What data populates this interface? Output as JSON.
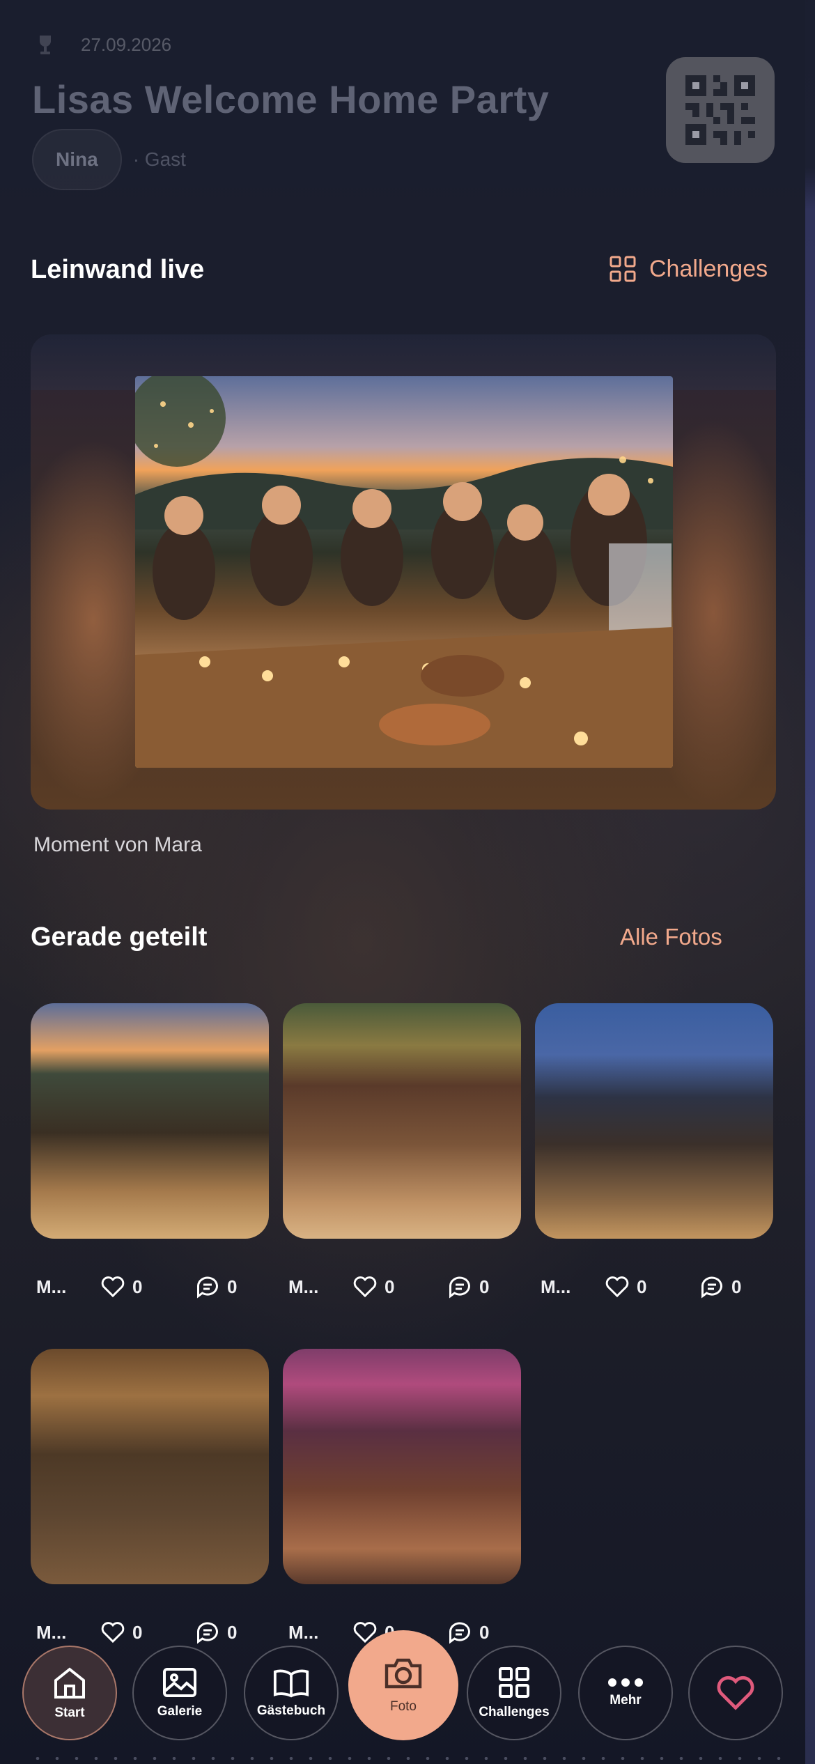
{
  "event": {
    "date": "27.09.2026",
    "title": "Lisas Welcome Home Party",
    "user_name": "Nina",
    "user_role": "· Gast"
  },
  "live": {
    "title": "Leinwand live",
    "challenges_link": "Challenges",
    "caption": "Moment von Mara"
  },
  "shared": {
    "title": "Gerade geteilt",
    "all_photos_link": "Alle Fotos",
    "photos": [
      {
        "author": "M...",
        "likes": "0",
        "comments": "0"
      },
      {
        "author": "M...",
        "likes": "0",
        "comments": "0"
      },
      {
        "author": "M...",
        "likes": "0",
        "comments": "0"
      },
      {
        "author": "M...",
        "likes": "0",
        "comments": "0"
      },
      {
        "author": "M...",
        "likes": "0",
        "comments": "0"
      }
    ]
  },
  "nav": {
    "items": [
      {
        "label": "Start",
        "icon": "home-icon",
        "active": true
      },
      {
        "label": "Galerie",
        "icon": "image-icon"
      },
      {
        "label": "Gästebuch",
        "icon": "book-icon"
      },
      {
        "label": "Foto",
        "icon": "camera-icon"
      },
      {
        "label": "Challenges",
        "icon": "grid-icon"
      },
      {
        "label": "Mehr",
        "icon": "more-icon"
      },
      {
        "label": "",
        "icon": "heart-icon"
      }
    ]
  },
  "colors": {
    "accent": "#f2a98c",
    "background": "#151827",
    "heart": "#e05a7c"
  }
}
